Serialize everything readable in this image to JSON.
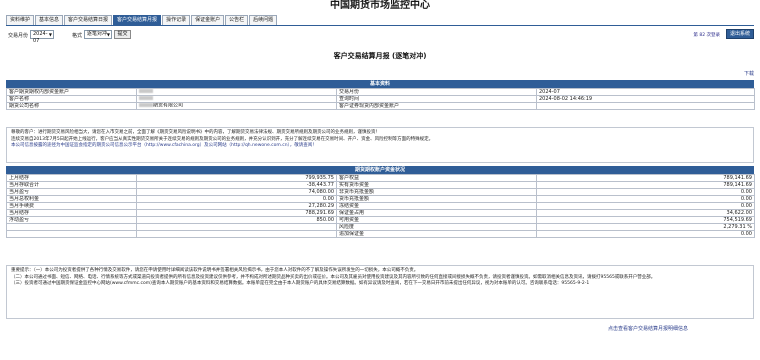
{
  "site_title": "中国期货市场监控中心",
  "nav": {
    "tabs": [
      "资料维护",
      "基本信息",
      "客户交易结算日报",
      "客户交易结算月报",
      "操作记录",
      "保证金账户",
      "公告栏",
      "后续问题"
    ],
    "active_index": 3
  },
  "toolbar": {
    "month_label": "交易月份",
    "month_value": "2024-07",
    "format_label": "格式",
    "format_value": "逐笔对冲",
    "query_button": "提交",
    "user_info": "第 82 次登录",
    "logout_button": "退出系统"
  },
  "report_title": "客户交易结算月报 (逐笔对冲)",
  "download_link": "下载",
  "basic": {
    "header": "基本资料",
    "rows": [
      [
        "客户期货期权内部资金账户",
        "",
        "交易月份",
        "2024-07"
      ],
      [
        "客户名称",
        "",
        "查询时间",
        "2024-08-02 14:46:19"
      ],
      [
        "期货公司名称",
        "期货有限公司",
        "客户证券现货内部资金账户",
        ""
      ]
    ]
  },
  "notice_1": [
    "尊敬的客户：进行期货交易风险相当大，请您在入市交易之前，全面了解《期货交易风险说明书》中的内容，了解期货交易法律法规、期货交易所规则及期货公司的业务规则，谨慎投资！",
    "连续交易自2013年7月5日起开始上线运行，客户应当从真实性期货交易所关于连续交易的规则及期货公司的业务规则，并充分认识到开，充分了解连续交易在交易时间、开户、资金、风险控制等方面的特殊规定。",
    "本公司信息披露的途径为中国证监会指定的期货公司信息公示平台（http://www.cfachina.org）及公司网站（http://qh.newone.com.cn），敬请查阅！"
  ],
  "fund": {
    "header": "期货期权账户资金状况",
    "rows": [
      [
        "上月结存",
        "799,935.75",
        "客户权益",
        "789,141.69"
      ],
      [
        "当月存取合计",
        "-38,443.77",
        "实有货币资金",
        "789,141.69"
      ],
      [
        "当月盈亏",
        "74,080.00",
        "非货币充抵金额",
        "0.00"
      ],
      [
        "当月总权利金",
        "0.00",
        "货币充抵金额",
        "0.00"
      ],
      [
        "当月手续费",
        "27,280.29",
        "冻结资金",
        "0.00"
      ],
      [
        "当月结存",
        "788,291.69",
        "保证金占用",
        "34,622.00"
      ],
      [
        "浮动盈亏",
        "850.00",
        "可用资金",
        "754,519.69"
      ],
      [
        "",
        "",
        "风险度",
        "2,279.31 %"
      ],
      [
        "",
        "",
        "追加保证金",
        "0.00"
      ]
    ]
  },
  "notice_2": [
    "重要提示：（一）本公司为投资者提供了各种行情及交易软件，请您在申请使用时详细阅读该软件说明书并签署相关风险揭示书，由于您本人对软件的不了解及操作失误所发生的一切损失，本公司概不负责。",
    "（二）本公司通过书面、短信、网络、电话、行情系统等方式或渠道向投资者提供的所有信息及投资建议仅供参考，并不构成对所述期货品种买卖的出价或征价。本公司及其雇员对使用投资建议及其内容所引致的任何直接或间接损失概不负责，请投资者谨慎投资。如需取消相关信息及资讯，请拨打95565或联系开户营业部。",
    "（三）投资者可通过中国期货保证金监控中心网站(www.cfmmc.com)查询本人期货账户的基本资料和交易结算数据。本账单是在完全由于本人期货账户的具体交易结算数据。如有异议请及时查阅，若在下一交易日开市前未提出任何异议，视为对本账单的认可。咨询联系电话：95565-9-2-1"
  ],
  "footer_link": "点击查看客户交易结算月报明细信息"
}
